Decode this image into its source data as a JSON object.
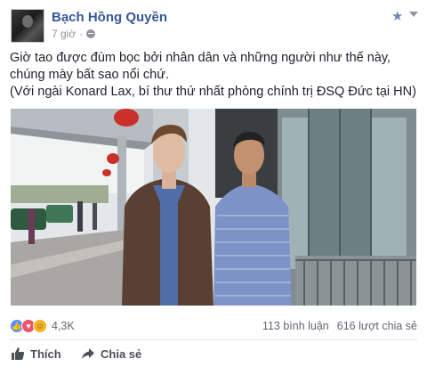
{
  "post": {
    "author": "Bạch Hồng Quyền",
    "time": "7 giờ",
    "separator": "·",
    "text_line1": "Giờ tao được đùm bọc bởi nhân dân và những người như thế này, chúng mày bất sao nổi chứ.",
    "text_line2": "(Với ngài Konard Lax, bí thư thứ nhất phòng chính trị ĐSQ Đức tại HN)"
  },
  "stats": {
    "reactions_count": "4,3K",
    "comments": "113 bình luận",
    "shares": "616 lượt chia sẻ"
  },
  "actions": {
    "like_label": "Thích",
    "share_label": "Chia sẻ"
  },
  "icons": {
    "privacy": "globe-icon",
    "favorite": "star-icon",
    "menu": "chevron-down-icon",
    "like": "thumbs-up-icon",
    "share": "share-arrow-icon"
  },
  "colors": {
    "author_link": "#365899",
    "meta_text": "#90949c",
    "like_reaction": "#5890ff",
    "love_reaction": "#f25268"
  }
}
